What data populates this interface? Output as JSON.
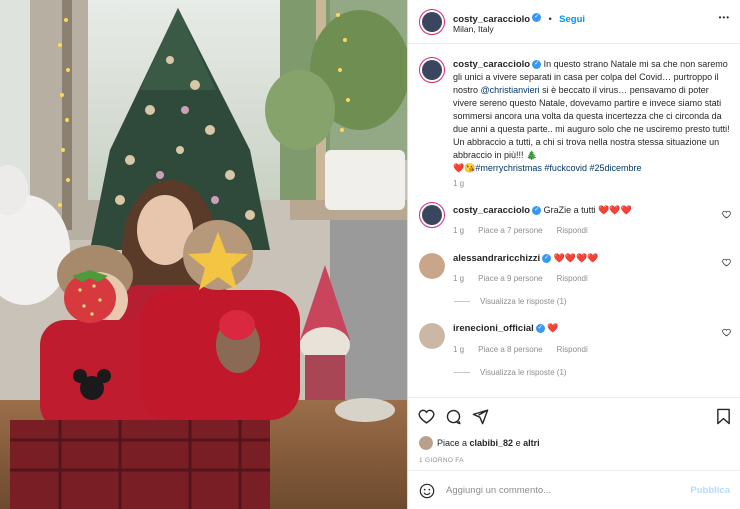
{
  "header": {
    "username": "costy_caracciolo",
    "follow_label": "Segui",
    "separator": "•",
    "location": "Milan, Italy",
    "more_label": "•••"
  },
  "caption": {
    "username": "costy_caracciolo",
    "text_1": " In questo strano Natale mi sa che non saremo gli unici a vivere separati in casa per colpa del Covid… purtroppo il nostro ",
    "mention": "@christianvieri",
    "text_2": " si è beccato il virus… pensavamo di poter vivere sereno questo Natale, dovevamo partire e invece siamo stati sommersi ancora una volta da questa incertezza che ci circonda da due anni a questa parte.. mi auguro solo che ne usciremo presto tutti! Un abbraccio a tutti, a chi si trova nella nostra stessa situazione un abbraccio in più!!! 🎄",
    "emoji_start": "❤️😘",
    "hashtags": "#merrychristmas #fuckcovid #25dicembre",
    "time": "1 g"
  },
  "comments": [
    {
      "username": "costy_caracciolo",
      "text": "GraZie a tutti ❤️❤️❤️",
      "time": "1 g",
      "likes": "Piace a 7 persone",
      "reply_label": "Rispondi"
    },
    {
      "username": "alessandraricchizzi",
      "text": "❤️❤️❤️❤️",
      "time": "1 g",
      "likes": "Piace a 9 persone",
      "reply_label": "Rispondi",
      "view_replies": "Visualizza le risposte (1)"
    },
    {
      "username": "irenecioni_official",
      "text": "❤️",
      "time": "1 g",
      "likes": "Piace a 8 persone",
      "reply_label": "Rispondi",
      "view_replies": "Visualizza le risposte (1)"
    }
  ],
  "likes_line": {
    "prefix": "Piace a ",
    "user": "clabibi_82",
    "suffix": " e ",
    "others": "altri"
  },
  "post_date": "1 GIORNO FA",
  "add_comment": {
    "placeholder": "Aggiungi un commento...",
    "publish_label": "Pubblica"
  },
  "photo": {
    "sticker_icon": "star-sticker"
  },
  "colors": {
    "accent": "#0095f6",
    "verified": "#3897f0",
    "heart": "#ed4956",
    "muted": "#8e8e8e"
  }
}
